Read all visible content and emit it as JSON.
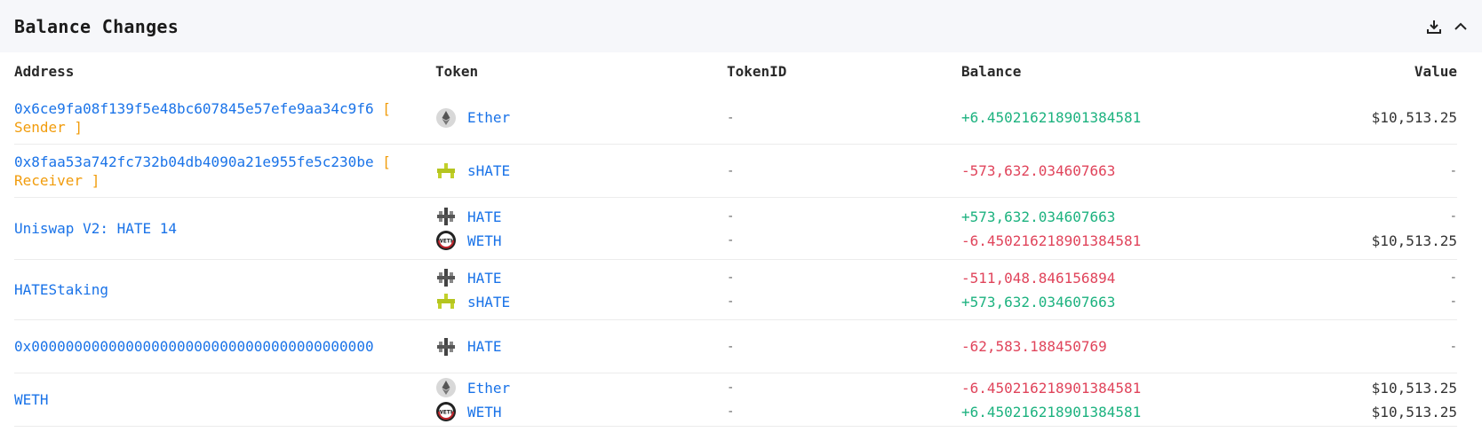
{
  "title": "Balance Changes",
  "headers": {
    "address": "Address",
    "token": "Token",
    "tokenid": "TokenID",
    "balance": "Balance",
    "value": "Value"
  },
  "rows": [
    {
      "address": "0x6ce9fa08f139f5e48bc607845e57efe9aa34c9f6",
      "tag": "[ Sender ]",
      "items": [
        {
          "token": "Ether",
          "icon": "ether-icon",
          "id": "-",
          "balance": "+6.450216218901384581",
          "sign": "pos",
          "value": "$10,513.25"
        }
      ]
    },
    {
      "address": "0x8faa53a742fc732b04db4090a21e955fe5c230be",
      "tag": "[ Receiver ]",
      "items": [
        {
          "token": "sHATE",
          "icon": "shate-icon",
          "id": "-",
          "balance": "-573,632.034607663",
          "sign": "neg",
          "value": "-"
        }
      ]
    },
    {
      "address": "Uniswap V2: HATE 14",
      "tag": "",
      "items": [
        {
          "token": "HATE",
          "icon": "hate-icon",
          "id": "-",
          "balance": "+573,632.034607663",
          "sign": "pos",
          "value": "-"
        },
        {
          "token": "WETH",
          "icon": "weth-icon",
          "id": "-",
          "balance": "-6.450216218901384581",
          "sign": "neg",
          "value": "$10,513.25"
        }
      ]
    },
    {
      "address": "HATEStaking",
      "tag": "",
      "items": [
        {
          "token": "HATE",
          "icon": "hate-icon",
          "id": "-",
          "balance": "-511,048.846156894",
          "sign": "neg",
          "value": "-"
        },
        {
          "token": "sHATE",
          "icon": "shate-icon",
          "id": "-",
          "balance": "+573,632.034607663",
          "sign": "pos",
          "value": "-"
        }
      ]
    },
    {
      "address": "0x0000000000000000000000000000000000000000",
      "tag": "",
      "items": [
        {
          "token": "HATE",
          "icon": "hate-icon",
          "id": "-",
          "balance": "-62,583.188450769",
          "sign": "neg",
          "value": "-"
        }
      ]
    },
    {
      "address": "WETH",
      "tag": "",
      "items": [
        {
          "token": "Ether",
          "icon": "ether-icon",
          "id": "-",
          "balance": "-6.450216218901384581",
          "sign": "neg",
          "value": "$10,513.25"
        },
        {
          "token": "WETH",
          "icon": "weth-icon",
          "id": "-",
          "balance": "+6.450216218901384581",
          "sign": "pos",
          "value": "$10,513.25"
        }
      ]
    }
  ]
}
